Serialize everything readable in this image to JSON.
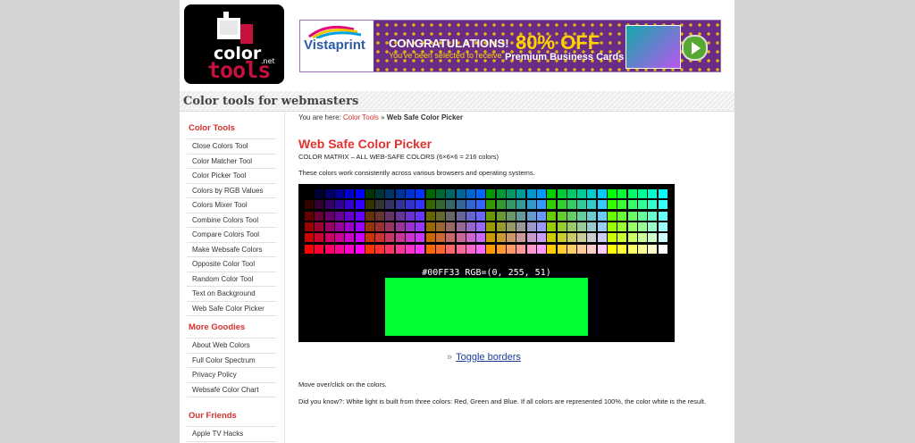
{
  "logo": {
    "word1": "color",
    "net": ".net",
    "word2": "tools"
  },
  "ad": {
    "brand": "Vistaprint",
    "headline": "CONGRATULATIONS!",
    "subline": "You've been selected to receive",
    "offer": "80% OFF",
    "product": "Premium Business Cards"
  },
  "site_title": "Color tools for webmasters",
  "sidebar": {
    "color_tools_heading": "Color Tools",
    "color_tools": [
      "Close Colors Tool",
      "Color Matcher Tool",
      "Color Picker Tool",
      "Colors by RGB Values",
      "Colors Mixer Tool",
      "Combine Colors Tool",
      "Compare Colors Tool",
      "Make Websafe Colors",
      "Opposite Color Tool",
      "Random Color Tool",
      "Text on Background",
      "Web Safe Color Picker"
    ],
    "more_heading": "More Goodies",
    "more": [
      "About Web Colors",
      "Full Color Spectrum",
      "Privacy Policy",
      "Websafe Color Chart"
    ],
    "friends_heading": "Our Friends",
    "friends": [
      "Apple TV Hacks"
    ]
  },
  "breadcrumb": {
    "prefix": "You are here: ",
    "link": "Color Tools",
    "sep": " » ",
    "current": "Web Safe Color Picker"
  },
  "page_title": "Web Safe Color Picker",
  "subtitle": "COLOR MATRIX – ALL WEB-SAFE COLORS (6×6×6 = 216 colors)",
  "description": "These colors work consistently across various browsers and operating systems.",
  "picker": {
    "readout": "#00FF33  RGB=(0, 255, 51)",
    "selected_color": "#00ff33",
    "levels": [
      0,
      51,
      102,
      153,
      204,
      255
    ]
  },
  "toggle": {
    "raquo": "»",
    "label": "Toggle borders"
  },
  "instructions": "Move over/click on the colors.",
  "did_you_know": "Did you know?: White light is built from three colors: Red, Green and Blue. If all colors are represented 100%, the color white is the result.",
  "colors": {
    "accent_red": "#e2322f",
    "link_blue": "#1a3d99",
    "background": "#d3d3d3"
  }
}
